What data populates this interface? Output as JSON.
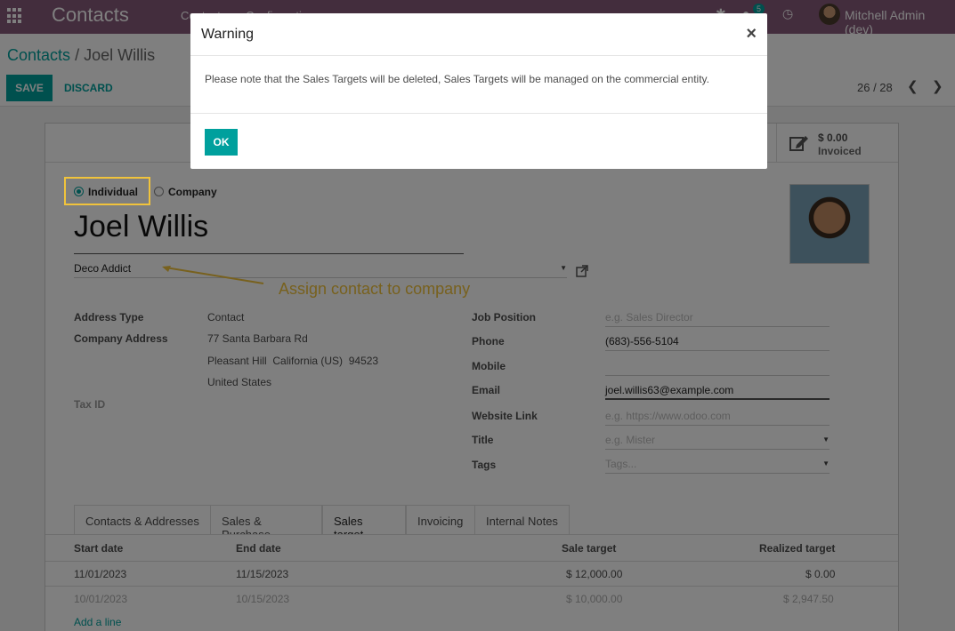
{
  "navbar": {
    "app_title": "Contacts",
    "menu": [
      "Contacts",
      "Configuration"
    ],
    "chat_badge": "5",
    "user_name": "Mitchell Admin (dev)"
  },
  "control_panel": {
    "breadcrumb_root": "Contacts",
    "breadcrumb_sep": "/",
    "breadcrumb_current": "Joel Willis",
    "save_label": "SAVE",
    "discard_label": "DISCARD",
    "pager": "26 / 28"
  },
  "stat_button": {
    "value": "$ 0.00",
    "label": "Invoiced"
  },
  "form": {
    "type_options": [
      "Individual",
      "Company"
    ],
    "selected_type": "Individual",
    "name": "Joel Willis",
    "company": "Deco Addict",
    "left": {
      "address_type_label": "Address Type",
      "address_type_value": "Contact",
      "company_address_label": "Company Address",
      "street": "77 Santa Barbara Rd",
      "city_line": "Pleasant Hill  California (US)  94523",
      "country": "United States",
      "tax_id_label": "Tax ID"
    },
    "right": {
      "job_position_label": "Job Position",
      "job_position_placeholder": "e.g. Sales Director",
      "phone_label": "Phone",
      "phone_value": "(683)-556-5104",
      "mobile_label": "Mobile",
      "email_label": "Email",
      "email_value": "joel.willis63@example.com",
      "website_label": "Website Link",
      "website_placeholder": "e.g. https://www.odoo.com",
      "title_label": "Title",
      "title_placeholder": "e.g. Mister",
      "tags_label": "Tags",
      "tags_placeholder": "Tags..."
    }
  },
  "tabs": [
    "Contacts & Addresses",
    "Sales & Purchase",
    "Sales target",
    "Invoicing",
    "Internal Notes"
  ],
  "active_tab": "Sales target",
  "sales_target_table": {
    "headers": [
      "Start date",
      "End date",
      "Sale target",
      "Realized target"
    ],
    "rows": [
      [
        "11/01/2023",
        "11/15/2023",
        "$ 12,000.00",
        "$ 0.00"
      ],
      [
        "10/01/2023",
        "10/15/2023",
        "$ 10,000.00",
        "$ 2,947.50"
      ]
    ],
    "add_line": "Add a line"
  },
  "annotation": "Assign contact to company",
  "dialog": {
    "title": "Warning",
    "close": "×",
    "message": "Please note that the Sales Targets will be deleted, Sales Targets will be managed on the commercial entity.",
    "ok_label": "OK"
  },
  "colors": {
    "navbar": "#875a7b",
    "primary": "#00a09d",
    "annotation": "#f0c33c"
  }
}
